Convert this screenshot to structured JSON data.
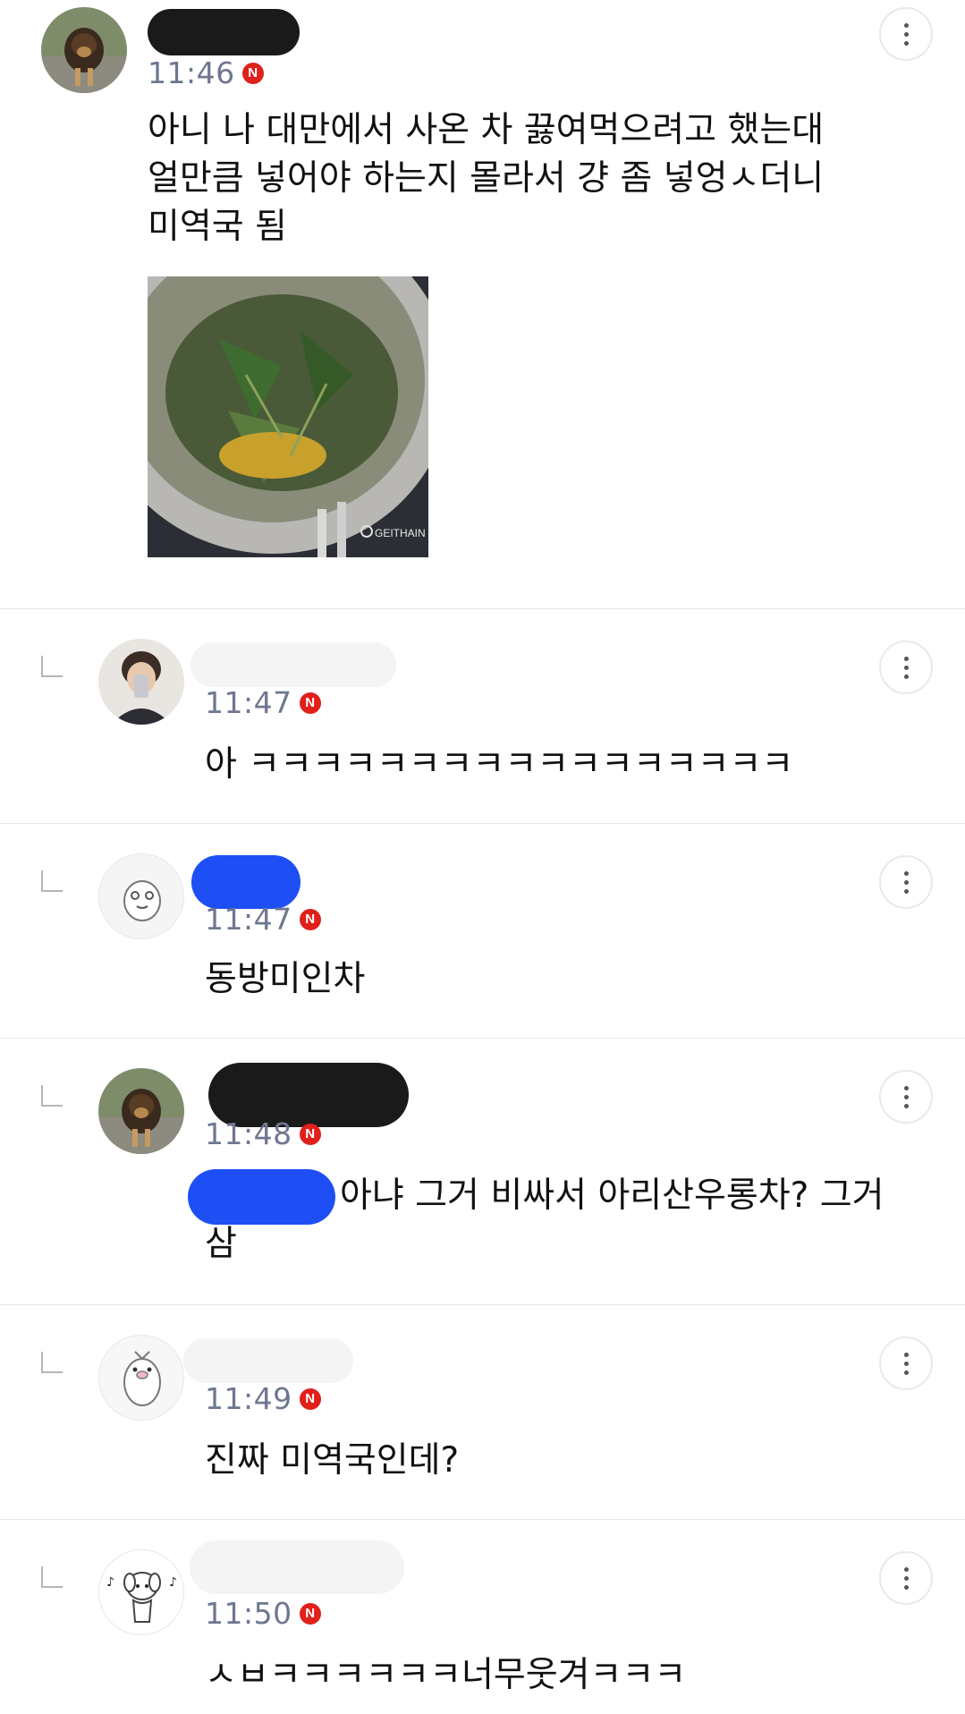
{
  "comments": [
    {
      "time": "11:46",
      "text_lines": [
        "아니 나 대만에서 사온 차 끓여먹으려고 했는대",
        "얼만큼 넣어야 하는지 몰라서 걍 좀 넣엉ㅅ더니",
        "미역국 됨"
      ],
      "badge": "N",
      "photo_label": "GEITHAIN"
    },
    {
      "time": "11:47",
      "text_lines": [
        "아 ㅋㅋㅋㅋㅋㅋㅋㅋㅋㅋㅋㅋㅋㅋㅋㅋㅋ"
      ],
      "badge": "N"
    },
    {
      "time": "11:47",
      "text_lines": [
        "동방미인차"
      ],
      "badge": "N"
    },
    {
      "time": "11:48",
      "text_lines": [
        "아냐 그거 비싸서 아리산우롱차?  그거",
        "삼"
      ],
      "badge": "N"
    },
    {
      "time": "11:49",
      "text_lines": [
        "진짜 미역국인데?"
      ],
      "badge": "N"
    },
    {
      "time": "11:50",
      "text_lines": [
        "ㅅㅂㅋㅋㅋㅋㅋㅋ너무웃겨ㅋㅋㅋ"
      ],
      "badge": "N"
    }
  ],
  "colors": {
    "badge": "#e0201b",
    "time": "#6e7790",
    "divider": "#e6e6e6",
    "redact_black": "#1a1a1a",
    "redact_blue": "#1e4ff5"
  },
  "icons": [
    "more-vertical-icon",
    "reply-arrow-icon",
    "new-badge-icon"
  ]
}
